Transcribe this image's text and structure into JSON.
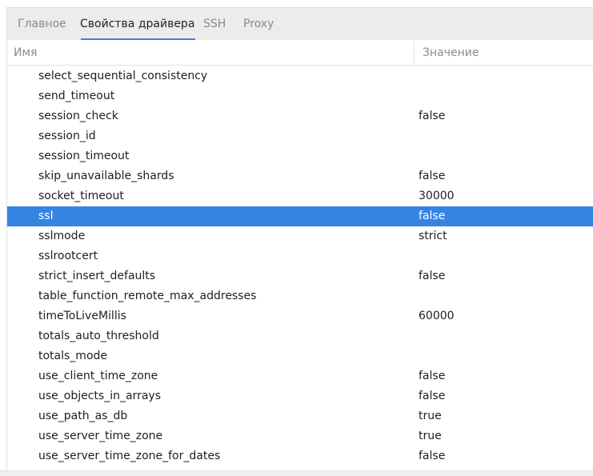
{
  "tabs": [
    {
      "label": "Главное"
    },
    {
      "label": "Свойства драйвера"
    },
    {
      "label": "SSH"
    },
    {
      "label": "Proxy"
    }
  ],
  "active_tab": "Свойства драйвера",
  "columns": {
    "name": "Имя",
    "value": "Значение"
  },
  "selected_row": "ssl",
  "rows": [
    {
      "name": "select_sequential_consistency",
      "value": ""
    },
    {
      "name": "send_timeout",
      "value": ""
    },
    {
      "name": "session_check",
      "value": "false"
    },
    {
      "name": "session_id",
      "value": ""
    },
    {
      "name": "session_timeout",
      "value": ""
    },
    {
      "name": "skip_unavailable_shards",
      "value": "false"
    },
    {
      "name": "socket_timeout",
      "value": "30000"
    },
    {
      "name": "ssl",
      "value": "false"
    },
    {
      "name": "sslmode",
      "value": "strict"
    },
    {
      "name": "sslrootcert",
      "value": ""
    },
    {
      "name": "strict_insert_defaults",
      "value": "false"
    },
    {
      "name": "table_function_remote_max_addresses",
      "value": ""
    },
    {
      "name": "timeToLiveMillis",
      "value": "60000"
    },
    {
      "name": "totals_auto_threshold",
      "value": ""
    },
    {
      "name": "totals_mode",
      "value": ""
    },
    {
      "name": "use_client_time_zone",
      "value": "false"
    },
    {
      "name": "use_objects_in_arrays",
      "value": "false"
    },
    {
      "name": "use_path_as_db",
      "value": "true"
    },
    {
      "name": "use_server_time_zone",
      "value": "true"
    },
    {
      "name": "use_server_time_zone_for_dates",
      "value": "false"
    }
  ],
  "colors": {
    "accent": "#3584e4",
    "tabbar_bg": "#ececec",
    "muted_text": "#8a8a8a"
  }
}
